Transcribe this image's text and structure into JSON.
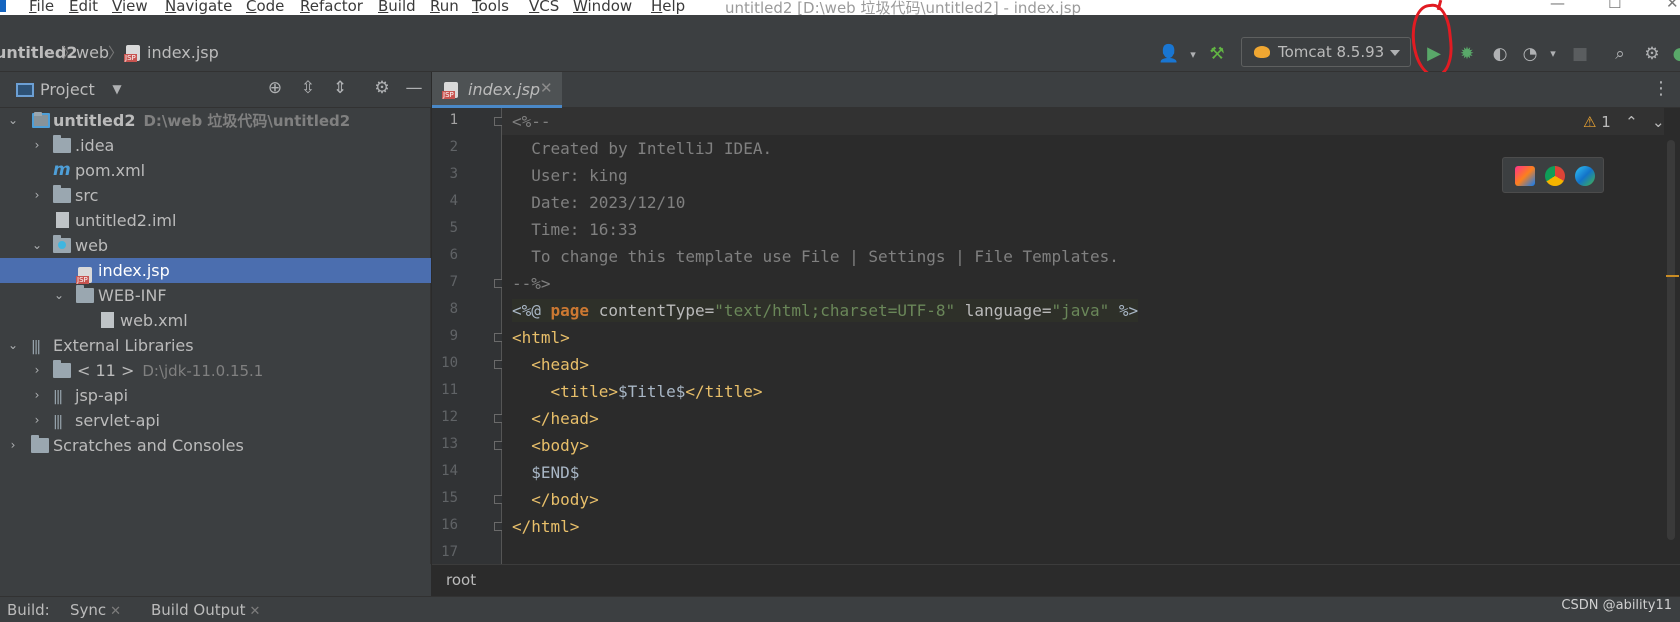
{
  "menu": {
    "items": [
      "File",
      "Edit",
      "View",
      "Navigate",
      "Code",
      "Refactor",
      "Build",
      "Run",
      "Tools",
      "VCS",
      "Window",
      "Help"
    ],
    "window_title": "untitled2 [D:\\web 垃圾代码\\untitled2] - index.jsp"
  },
  "breadcrumb": {
    "items": [
      "untitled2",
      "web",
      "index.jsp"
    ]
  },
  "toolbar": {
    "run_config": "Tomcat 8.5.93",
    "icons": [
      "user-icon",
      "hammer-icon",
      "run-icon",
      "debug-icon",
      "coverage-icon",
      "profile-icon",
      "stop-icon",
      "search-icon",
      "gear-icon"
    ]
  },
  "project_panel": {
    "title": "Project",
    "tree": [
      {
        "label": "untitled2",
        "hint": "D:\\web 垃圾代码\\untitled2",
        "icon": "module-folder-icon",
        "depth": 0,
        "expanded": true
      },
      {
        "label": ".idea",
        "icon": "folder-icon",
        "depth": 1,
        "expanded": false
      },
      {
        "label": "pom.xml",
        "icon": "maven-icon",
        "depth": 1
      },
      {
        "label": "src",
        "icon": "folder-icon",
        "depth": 1,
        "expanded": false
      },
      {
        "label": "untitled2.iml",
        "icon": "file-icon",
        "depth": 1
      },
      {
        "label": "web",
        "icon": "web-folder-icon",
        "depth": 1,
        "expanded": true
      },
      {
        "label": "index.jsp",
        "icon": "jsp-icon",
        "depth": 2,
        "selected": true
      },
      {
        "label": "WEB-INF",
        "icon": "folder-icon",
        "depth": 2,
        "expanded": true
      },
      {
        "label": "web.xml",
        "icon": "xml-icon",
        "depth": 3
      },
      {
        "label": "External Libraries",
        "icon": "library-icon",
        "depth": 0,
        "expanded": true
      },
      {
        "label": "< 11 >",
        "hint": "D:\\jdk-11.0.15.1",
        "icon": "jdk-folder-icon",
        "depth": 1,
        "expanded": false
      },
      {
        "label": "jsp-api",
        "icon": "library-icon",
        "depth": 1,
        "expanded": false
      },
      {
        "label": "servlet-api",
        "icon": "library-icon",
        "depth": 1,
        "expanded": false
      },
      {
        "label": "Scratches and Consoles",
        "icon": "scratches-icon",
        "depth": 0,
        "expanded": false
      }
    ]
  },
  "editor": {
    "tab": "index.jsp",
    "warnings": "1",
    "lines": [
      "<%--",
      "  Created by IntelliJ IDEA.",
      "  User: king",
      "  Date: 2023/12/10",
      "  Time: 16:33",
      "  To change this template use File | Settings | File Templates.",
      "--%>",
      "<%@ page contentType=\"text/html;charset=UTF-8\" language=\"java\" %>",
      "<html>",
      "  <head>",
      "    <title>$Title$</title>",
      "  </head>",
      "  <body>",
      "  $END$",
      "  </body>",
      "</html>",
      ""
    ],
    "line_numbers": [
      "1",
      "2",
      "3",
      "4",
      "5",
      "6",
      "7",
      "8",
      "9",
      "10",
      "11",
      "12",
      "13",
      "14",
      "15",
      "16",
      "17"
    ],
    "footer_crumb": "root"
  },
  "buildbar": {
    "label": "Build:",
    "tabs": [
      "Sync",
      "Build Output"
    ],
    "watermark": "CSDN @ability11"
  }
}
